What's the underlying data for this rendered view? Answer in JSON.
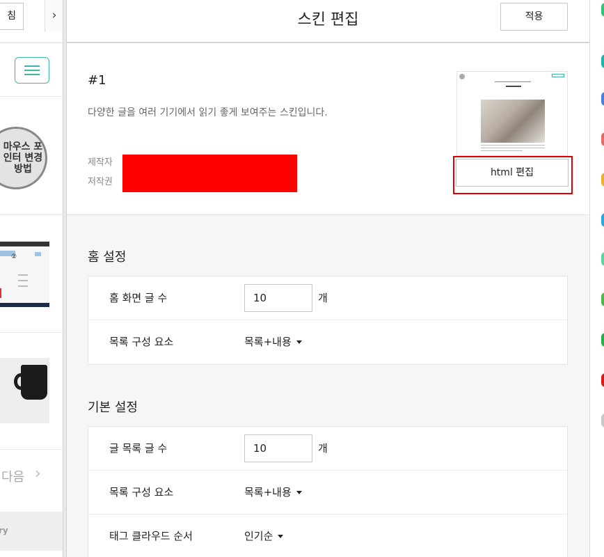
{
  "left_panel": {
    "refresh_label": "침",
    "collapse_icon": "›",
    "preview_circle_text": "마우스 포인터 변경방법",
    "screen_marker": "②",
    "next_label": "다음",
    "next_icon": "›",
    "footer_label": "ry"
  },
  "header": {
    "title": "스킨 편집",
    "apply_label": "적용"
  },
  "skin": {
    "name": "#1",
    "description": "다양한 글을 여러 기기에서 읽기 좋게 보여주는 스킨입니다.",
    "author_label": "제작자",
    "copyright_label": "저작권",
    "html_edit_label": "html 편집"
  },
  "home_settings": {
    "title": "홈 설정",
    "rows": [
      {
        "label": "홈 화면 글 수",
        "value": "10",
        "unit": "개"
      },
      {
        "label": "목록 구성 요소",
        "value": "목록+내용"
      }
    ]
  },
  "basic_settings": {
    "title": "기본 설정",
    "rows": [
      {
        "label": "글 목록 글 수",
        "value": "10",
        "unit": "개"
      },
      {
        "label": "목록 구성 요소",
        "value": "목록+내용"
      },
      {
        "label": "태그 클라우드 순서",
        "value": "인기순"
      }
    ]
  },
  "colors": {
    "accent": "#3fb6a0",
    "highlight": "#e00000",
    "redaction": "#ff0000"
  }
}
